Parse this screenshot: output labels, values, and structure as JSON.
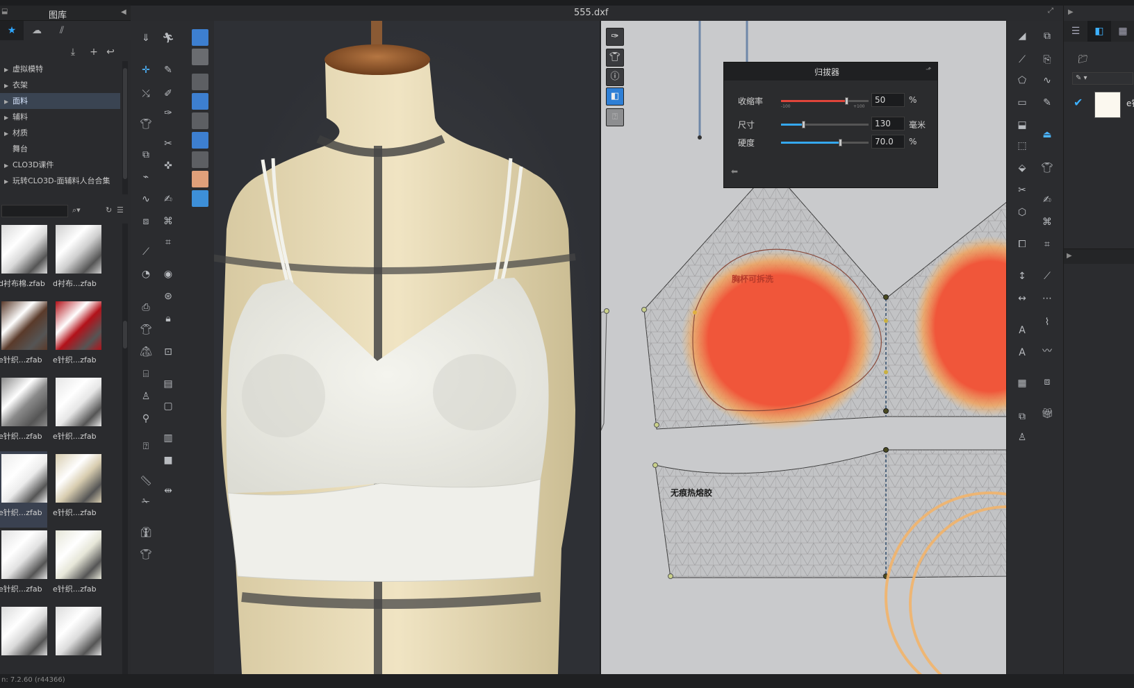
{
  "library": {
    "title": "图库",
    "tree": [
      {
        "label": "虚拟模特",
        "arrow": true
      },
      {
        "label": "衣架",
        "arrow": true
      },
      {
        "label": "面料",
        "arrow": true,
        "active": true
      },
      {
        "label": "辅料",
        "arrow": true
      },
      {
        "label": "材质",
        "arrow": true
      },
      {
        "label": "舞台",
        "arrow": false
      },
      {
        "label": "CLO3D课件",
        "arrow": true
      },
      {
        "label": "玩转CLO3D-面辅料人台合集",
        "arrow": true
      }
    ],
    "search_value": "",
    "thumbnails": [
      {
        "label": "d衬布棉.zfab",
        "color": "#d9d9d9"
      },
      {
        "label": "d衬布...zfab",
        "color": "#cfcfcf"
      },
      {
        "label": "e针织...zfab",
        "color": "#5a3a2a"
      },
      {
        "label": "e针织...zfab",
        "color": "#b3121a"
      },
      {
        "label": "e针织...zfab",
        "color": "#8a8a8a"
      },
      {
        "label": "e针织...zfab",
        "color": "#e6e6e6"
      },
      {
        "label": "e针织...zfab",
        "color": "#ececec",
        "selected": true
      },
      {
        "label": "e针织...zfab",
        "color": "#d8cdb0"
      },
      {
        "label": "e针织...zfab",
        "color": "#e2e2e2"
      },
      {
        "label": "e针织...zfab",
        "color": "#e6e6d8"
      },
      {
        "label": "",
        "color": "#dadada"
      },
      {
        "label": "",
        "color": "#dcdcdc"
      }
    ]
  },
  "document": {
    "title": "555.dxf"
  },
  "shrink_panel": {
    "title": "归拔器",
    "rows": [
      {
        "label": "收缩率",
        "value": "50",
        "unit": "%",
        "fraction": 0.75,
        "fill": "#e0453a",
        "ticks": [
          "-100",
          "+100"
        ]
      },
      {
        "label": "尺寸",
        "value": "130",
        "unit": "毫米",
        "fraction": 0.26,
        "fill": "#35a8ef",
        "ticks": []
      },
      {
        "label": "硬度",
        "value": "70.0",
        "unit": "%",
        "fraction": 0.68,
        "fill": "#35a8ef",
        "ticks": []
      }
    ]
  },
  "pattern_labels": {
    "cup_piece": "胸杯可拆洗",
    "band_piece": "无痕热熔胶"
  },
  "object_browser": {
    "item_label": "e针",
    "item_color": "#fbf8ef"
  },
  "status": {
    "version": "n: 7.2.60 (r44366)"
  },
  "colors": {
    "accent": "#2ea6ff",
    "pressure": "#f0563a",
    "shrink_fill": "#e0453a"
  }
}
